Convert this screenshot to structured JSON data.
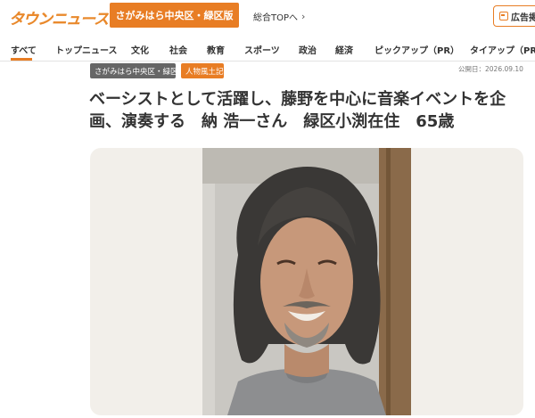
{
  "header": {
    "logo_text": "タウンニュース",
    "edition_label": "さがみはら中央区・緑区版",
    "top_link_label": "総合TOPへ",
    "ad_label": "広告掲"
  },
  "nav": {
    "items": [
      {
        "label": "すべて",
        "active": true
      },
      {
        "label": "トップニュース"
      },
      {
        "label": "文化"
      },
      {
        "label": "社会"
      },
      {
        "label": "教育"
      },
      {
        "label": "スポーツ"
      },
      {
        "label": "政治"
      },
      {
        "label": "経済"
      },
      {
        "label": "ピックアップ（PR）"
      },
      {
        "label": "タイアップ（PR）"
      }
    ]
  },
  "article": {
    "area_tag": "さがみはら中央区・緑区",
    "category_tag": "人物風土記",
    "published": "公開日：2026.09.10",
    "title": "ベーシストとして活躍し、藤野を中心に音楽イベントを企画、演奏する　納 浩一さん　緑区小渕在住　65歳"
  },
  "colors": {
    "accent": "#e87d24",
    "logo": "#e9892c",
    "tag_gray": "#666666"
  }
}
